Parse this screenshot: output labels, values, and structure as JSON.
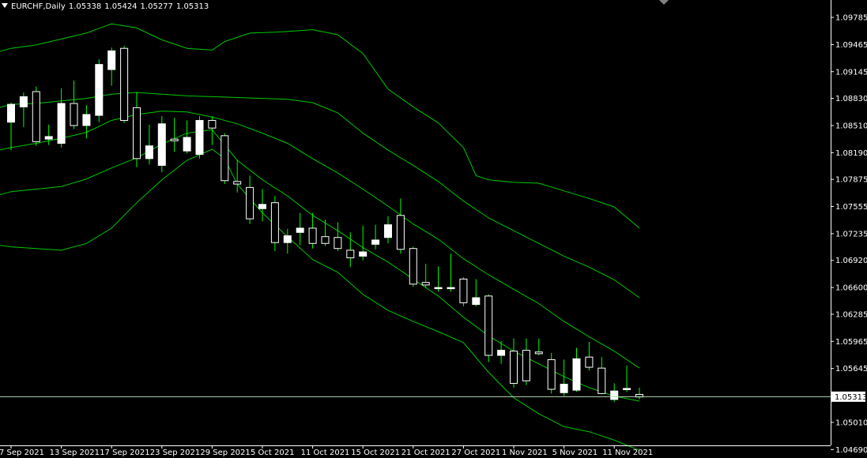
{
  "header": {
    "symbol": "EURCHF,Daily",
    "open": "1.05338",
    "high": "1.05424",
    "low": "1.05277",
    "close": "1.05313"
  },
  "colors": {
    "background": "#000000",
    "axis": "#ffffff",
    "bullish_fill": "#ffffff",
    "bearish_fill": "#000000",
    "wick": "#00ff00",
    "bands": "#00c800",
    "price_line": "#b4dcb4"
  },
  "chart_data": {
    "type": "candlestick",
    "symbol": "EURCHF",
    "timeframe": "Daily",
    "current_price": "1.05313",
    "y_range": [
      1.0459,
      1.0999
    ],
    "y_ticks": [
      "1.09785",
      "1.09465",
      "1.09145",
      "1.08830",
      "1.08510",
      "1.08190",
      "1.07875",
      "1.07555",
      "1.07235",
      "1.06920",
      "1.06600",
      "1.06285",
      "1.05965",
      "1.05645",
      "1.05010",
      "1.04690"
    ],
    "x_ticks": [
      {
        "label": "7 Sep 2021",
        "index": 0
      },
      {
        "label": "13 Sep 2021",
        "index": 4
      },
      {
        "label": "17 Sep 2021",
        "index": 8
      },
      {
        "label": "23 Sep 2021",
        "index": 12
      },
      {
        "label": "29 Sep 2021",
        "index": 16
      },
      {
        "label": "5 Oct 2021",
        "index": 20
      },
      {
        "label": "11 Oct 2021",
        "index": 24
      },
      {
        "label": "15 Oct 2021",
        "index": 28
      },
      {
        "label": "21 Oct 2021",
        "index": 32
      },
      {
        "label": "27 Oct 2021",
        "index": 36
      },
      {
        "label": "1 Nov 2021",
        "index": 40
      },
      {
        "label": "5 Nov 2021",
        "index": 44
      },
      {
        "label": "11 Nov 2021",
        "index": 48
      }
    ],
    "candles": [
      {
        "o": 1.0855,
        "h": 1.0878,
        "l": 1.0822,
        "c": 1.0876
      },
      {
        "o": 1.0873,
        "h": 1.089,
        "l": 1.0849,
        "c": 1.0885
      },
      {
        "o": 1.0891,
        "h": 1.0897,
        "l": 1.0827,
        "c": 1.0832
      },
      {
        "o": 1.0835,
        "h": 1.0852,
        "l": 1.0828,
        "c": 1.0838
      },
      {
        "o": 1.083,
        "h": 1.0895,
        "l": 1.0825,
        "c": 1.0877
      },
      {
        "o": 1.0877,
        "h": 1.0904,
        "l": 1.0847,
        "c": 1.0851
      },
      {
        "o": 1.0851,
        "h": 1.0875,
        "l": 1.0836,
        "c": 1.0864
      },
      {
        "o": 1.0863,
        "h": 1.0929,
        "l": 1.0855,
        "c": 1.0923
      },
      {
        "o": 1.0917,
        "h": 1.0943,
        "l": 1.0898,
        "c": 1.0939
      },
      {
        "o": 1.0942,
        "h": 1.0945,
        "l": 1.0854,
        "c": 1.0857
      },
      {
        "o": 1.0872,
        "h": 1.089,
        "l": 1.0802,
        "c": 1.0812
      },
      {
        "o": 1.0812,
        "h": 1.0852,
        "l": 1.0805,
        "c": 1.0827
      },
      {
        "o": 1.0804,
        "h": 1.0862,
        "l": 1.0796,
        "c": 1.0853
      },
      {
        "o": 1.0835,
        "h": 1.086,
        "l": 1.082,
        "c": 1.0833
      },
      {
        "o": 1.0821,
        "h": 1.0857,
        "l": 1.0818,
        "c": 1.0837
      },
      {
        "o": 1.0817,
        "h": 1.0862,
        "l": 1.0812,
        "c": 1.0857
      },
      {
        "o": 1.0857,
        "h": 1.0862,
        "l": 1.0828,
        "c": 1.0848
      },
      {
        "o": 1.0839,
        "h": 1.0842,
        "l": 1.0782,
        "c": 1.0786
      },
      {
        "o": 1.0785,
        "h": 1.081,
        "l": 1.0772,
        "c": 1.0782
      },
      {
        "o": 1.0778,
        "h": 1.0792,
        "l": 1.0735,
        "c": 1.0741
      },
      {
        "o": 1.0753,
        "h": 1.0776,
        "l": 1.0738,
        "c": 1.0758
      },
      {
        "o": 1.076,
        "h": 1.0768,
        "l": 1.0703,
        "c": 1.0713
      },
      {
        "o": 1.0713,
        "h": 1.0729,
        "l": 1.07,
        "c": 1.0721
      },
      {
        "o": 1.0725,
        "h": 1.0748,
        "l": 1.071,
        "c": 1.073
      },
      {
        "o": 1.073,
        "h": 1.0748,
        "l": 1.0706,
        "c": 1.0712
      },
      {
        "o": 1.072,
        "h": 1.074,
        "l": 1.0709,
        "c": 1.0712
      },
      {
        "o": 1.0719,
        "h": 1.0737,
        "l": 1.0703,
        "c": 1.0706
      },
      {
        "o": 1.0704,
        "h": 1.0725,
        "l": 1.0684,
        "c": 1.0695
      },
      {
        "o": 1.0697,
        "h": 1.0733,
        "l": 1.0692,
        "c": 1.0702
      },
      {
        "o": 1.0711,
        "h": 1.0734,
        "l": 1.0705,
        "c": 1.0716
      },
      {
        "o": 1.0719,
        "h": 1.0744,
        "l": 1.0712,
        "c": 1.0734
      },
      {
        "o": 1.0745,
        "h": 1.0765,
        "l": 1.07,
        "c": 1.0705
      },
      {
        "o": 1.0706,
        "h": 1.0708,
        "l": 1.0661,
        "c": 1.0664
      },
      {
        "o": 1.0666,
        "h": 1.0688,
        "l": 1.066,
        "c": 1.0663
      },
      {
        "o": 1.066,
        "h": 1.0685,
        "l": 1.0655,
        "c": 1.066
      },
      {
        "o": 1.066,
        "h": 1.07,
        "l": 1.0655,
        "c": 1.066
      },
      {
        "o": 1.067,
        "h": 1.0672,
        "l": 1.0638,
        "c": 1.0642
      },
      {
        "o": 1.064,
        "h": 1.067,
        "l": 1.0638,
        "c": 1.0648
      },
      {
        "o": 1.065,
        "h": 1.0652,
        "l": 1.0572,
        "c": 1.058
      },
      {
        "o": 1.058,
        "h": 1.0597,
        "l": 1.057,
        "c": 1.0586
      },
      {
        "o": 1.0585,
        "h": 1.06,
        "l": 1.0542,
        "c": 1.0547
      },
      {
        "o": 1.0586,
        "h": 1.06,
        "l": 1.0545,
        "c": 1.055
      },
      {
        "o": 1.0584,
        "h": 1.06,
        "l": 1.058,
        "c": 1.0582
      },
      {
        "o": 1.0575,
        "h": 1.0583,
        "l": 1.0535,
        "c": 1.054
      },
      {
        "o": 1.0536,
        "h": 1.0575,
        "l": 1.0532,
        "c": 1.0546
      },
      {
        "o": 1.0539,
        "h": 1.0589,
        "l": 1.0537,
        "c": 1.0576
      },
      {
        "o": 1.0578,
        "h": 1.0596,
        "l": 1.0562,
        "c": 1.0566
      },
      {
        "o": 1.0565,
        "h": 1.0578,
        "l": 1.0534,
        "c": 1.0535
      },
      {
        "o": 1.0528,
        "h": 1.0547,
        "l": 1.0525,
        "c": 1.0538
      },
      {
        "o": 1.054,
        "h": 1.0568,
        "l": 1.0537,
        "c": 1.0541
      },
      {
        "o": 1.0534,
        "h": 1.0542,
        "l": 1.0528,
        "c": 1.0531
      }
    ],
    "bands": [
      {
        "name": "",
        "points": [
          [
            -1,
            1.0938
          ],
          [
            0,
            1.0942
          ],
          [
            2,
            1.0946
          ],
          [
            4,
            1.0953
          ],
          [
            6,
            1.096
          ],
          [
            8,
            1.0971
          ],
          [
            10,
            1.0966
          ],
          [
            12,
            1.0952
          ],
          [
            14,
            1.0942
          ],
          [
            16,
            1.094
          ],
          [
            17,
            1.095
          ],
          [
            19,
            1.096
          ],
          [
            21,
            1.0961
          ],
          [
            23,
            1.0963
          ],
          [
            24,
            1.0964
          ],
          [
            26,
            1.0958
          ],
          [
            28,
            1.0936
          ],
          [
            30,
            1.0894
          ],
          [
            32,
            1.0873
          ],
          [
            34,
            1.0854
          ],
          [
            36,
            1.0825
          ],
          [
            37,
            1.0792
          ],
          [
            38,
            1.0787
          ],
          [
            40,
            1.0784
          ],
          [
            42,
            1.0783
          ],
          [
            44,
            1.0774
          ],
          [
            46,
            1.0765
          ],
          [
            48,
            1.0755
          ],
          [
            50,
            1.073
          ]
        ]
      },
      {
        "name": "",
        "points": [
          [
            -1,
            1.0872
          ],
          [
            0,
            1.0876
          ],
          [
            2,
            1.0877
          ],
          [
            4,
            1.088
          ],
          [
            6,
            1.0883
          ],
          [
            8,
            1.0888
          ],
          [
            10,
            1.089
          ],
          [
            12,
            1.0888
          ],
          [
            14,
            1.0886
          ],
          [
            16,
            1.0885
          ],
          [
            18,
            1.0884
          ],
          [
            20,
            1.0883
          ],
          [
            22,
            1.0882
          ],
          [
            24,
            1.0878
          ],
          [
            26,
            1.0866
          ],
          [
            28,
            1.0842
          ],
          [
            30,
            1.0822
          ],
          [
            32,
            1.0804
          ],
          [
            34,
            1.0785
          ],
          [
            36,
            1.0762
          ],
          [
            38,
            1.0742
          ],
          [
            40,
            1.0727
          ],
          [
            42,
            1.0712
          ],
          [
            44,
            1.0697
          ],
          [
            46,
            1.0684
          ],
          [
            48,
            1.0669
          ],
          [
            50,
            1.0648
          ]
        ]
      },
      {
        "name": "",
        "points": [
          [
            -1,
            1.0822
          ],
          [
            0,
            1.0825
          ],
          [
            2,
            1.083
          ],
          [
            4,
            1.0836
          ],
          [
            6,
            1.0843
          ],
          [
            8,
            1.0857
          ],
          [
            10,
            1.0864
          ],
          [
            12,
            1.0868
          ],
          [
            14,
            1.0867
          ],
          [
            16,
            1.0861
          ],
          [
            18,
            1.0853
          ],
          [
            20,
            1.0842
          ],
          [
            22,
            1.083
          ],
          [
            24,
            1.0812
          ],
          [
            26,
            1.0795
          ],
          [
            28,
            1.0776
          ],
          [
            30,
            1.0756
          ],
          [
            32,
            1.0735
          ],
          [
            34,
            1.0717
          ],
          [
            36,
            1.0694
          ],
          [
            38,
            1.0675
          ],
          [
            40,
            1.0658
          ],
          [
            42,
            1.0641
          ],
          [
            44,
            1.062
          ],
          [
            46,
            1.0602
          ],
          [
            48,
            1.0585
          ],
          [
            50,
            1.0565
          ]
        ]
      },
      {
        "name": "",
        "points": [
          [
            -1,
            1.0769
          ],
          [
            0,
            1.0773
          ],
          [
            2,
            1.0776
          ],
          [
            4,
            1.0779
          ],
          [
            6,
            1.0788
          ],
          [
            8,
            1.0801
          ],
          [
            10,
            1.0813
          ],
          [
            12,
            1.0829
          ],
          [
            14,
            1.0842
          ],
          [
            16,
            1.0846
          ],
          [
            17,
            1.0828
          ],
          [
            18,
            1.081
          ],
          [
            20,
            1.0787
          ],
          [
            22,
            1.0768
          ],
          [
            24,
            1.0745
          ],
          [
            26,
            1.0727
          ],
          [
            28,
            1.0707
          ],
          [
            30,
            1.069
          ],
          [
            32,
            1.067
          ],
          [
            34,
            1.065
          ],
          [
            36,
            1.0625
          ],
          [
            38,
            1.0603
          ],
          [
            40,
            1.0585
          ],
          [
            42,
            1.057
          ],
          [
            44,
            1.0555
          ],
          [
            46,
            1.0542
          ],
          [
            48,
            1.0532
          ],
          [
            50,
            1.0526
          ]
        ]
      },
      {
        "name": "",
        "points": [
          [
            -1,
            1.071
          ],
          [
            0,
            1.0708
          ],
          [
            2,
            1.0706
          ],
          [
            4,
            1.0704
          ],
          [
            6,
            1.0712
          ],
          [
            8,
            1.073
          ],
          [
            10,
            1.076
          ],
          [
            12,
            1.0787
          ],
          [
            14,
            1.081
          ],
          [
            16,
            1.0823
          ],
          [
            17,
            1.0812
          ],
          [
            18,
            1.0782
          ],
          [
            20,
            1.0748
          ],
          [
            22,
            1.072
          ],
          [
            24,
            1.0693
          ],
          [
            26,
            1.0678
          ],
          [
            28,
            1.0652
          ],
          [
            30,
            1.0633
          ],
          [
            32,
            1.062
          ],
          [
            34,
            1.0608
          ],
          [
            36,
            1.0595
          ],
          [
            38,
            1.056
          ],
          [
            40,
            1.053
          ],
          [
            42,
            1.0511
          ],
          [
            44,
            1.0496
          ],
          [
            46,
            1.049
          ],
          [
            48,
            1.048
          ],
          [
            50,
            1.0468
          ]
        ]
      }
    ]
  }
}
